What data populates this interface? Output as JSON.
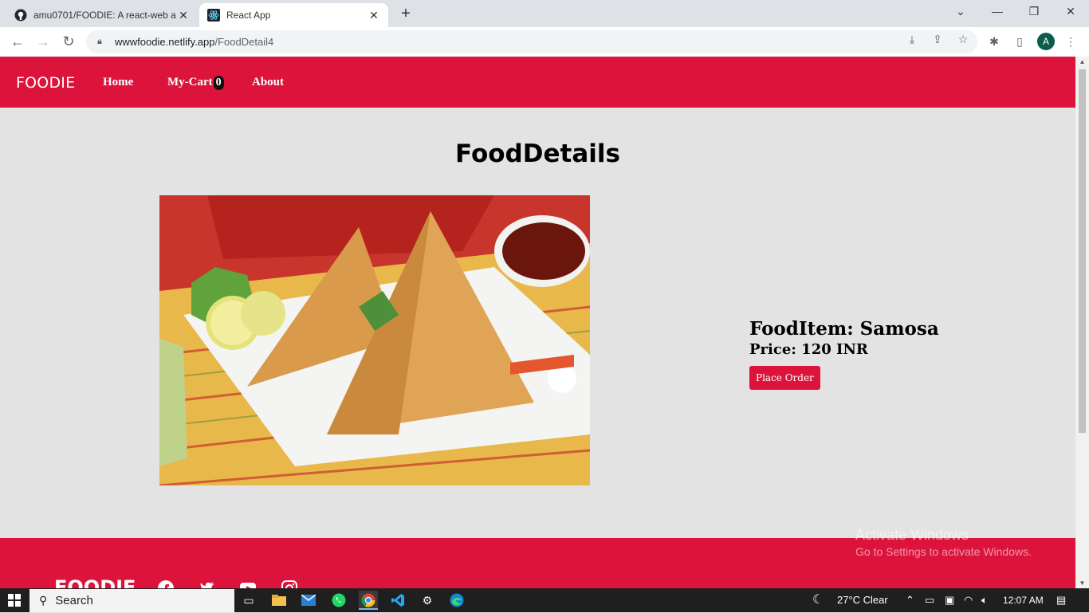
{
  "browser": {
    "tabs": [
      {
        "title": "amu0701/FOODIE: A react-web a",
        "icon": "github-icon",
        "active": false
      },
      {
        "title": "React App",
        "icon": "react-icon",
        "active": true
      }
    ],
    "url_host": "wwwfoodie.netlify.app",
    "url_path": "/FoodDetail4",
    "profile_initial": "A"
  },
  "site": {
    "brand": "FOODIE",
    "nav": {
      "home": "Home",
      "cart": "My-Cart",
      "cart_count": "0",
      "about": "About"
    },
    "heading": "FoodDetails",
    "food": {
      "item_line": "FoodItem: Samosa",
      "price_line": "Price: 120 INR",
      "order_label": "Place Order"
    },
    "footer_brand": "FOODIE",
    "social_icons": [
      "facebook-icon",
      "twitter-icon",
      "youtube-icon",
      "instagram-icon"
    ]
  },
  "watermark": {
    "line1": "Activate Windows",
    "line2": "Go to Settings to activate Windows."
  },
  "taskbar": {
    "search_placeholder": "Search",
    "weather": "27°C  Clear",
    "time": "12:07 AM"
  },
  "colors": {
    "brand": "#dc143c",
    "page_bg": "#e3e3e3"
  }
}
